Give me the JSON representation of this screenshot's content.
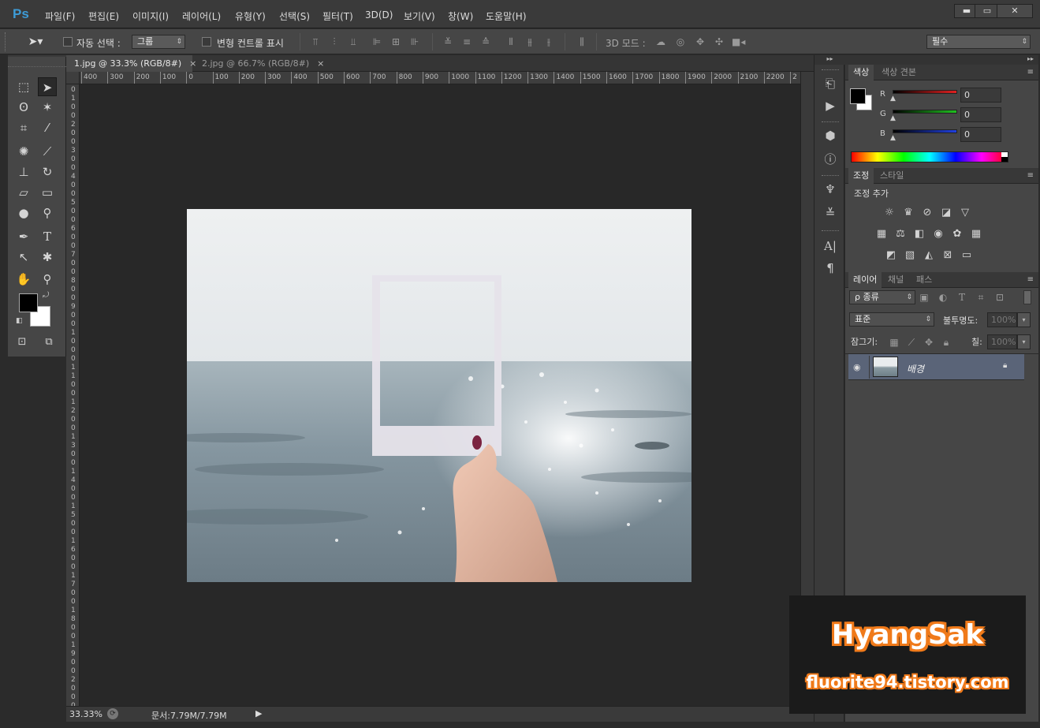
{
  "app": {
    "logo": "Ps"
  },
  "menu": [
    "파일(F)",
    "편집(E)",
    "이미지(I)",
    "레이어(L)",
    "유형(Y)",
    "선택(S)",
    "필터(T)",
    "3D(D)",
    "보기(V)",
    "창(W)",
    "도움말(H)"
  ],
  "window_controls": {
    "minimize": "▬",
    "maximize": "▭",
    "close": "✕"
  },
  "options": {
    "auto_select_label": "자동 선택 :",
    "auto_select_value": "그룹",
    "transform_label": "변형 컨트롤 표시",
    "mode_3d_label": "3D 모드 :",
    "workspace_value": "필수"
  },
  "documents": {
    "tabs": [
      {
        "label": "1.jpg @ 33.3% (RGB/8#)",
        "close": "×"
      },
      {
        "label": "2.jpg @ 66.7% (RGB/8#)",
        "close": "×"
      }
    ],
    "ruler_top": [
      "400",
      "300",
      "200",
      "100",
      "0",
      "100",
      "200",
      "300",
      "400",
      "500",
      "600",
      "700",
      "800",
      "900",
      "1000",
      "1100",
      "1200",
      "1300",
      "1400",
      "1500",
      "1600",
      "1700",
      "1800",
      "1900",
      "2000",
      "2100",
      "2200",
      "2"
    ],
    "ruler_left": [
      "0",
      "1",
      "0",
      "0",
      "2",
      "0",
      "0",
      "3",
      "0",
      "0",
      "4",
      "0",
      "0",
      "5",
      "0",
      "0",
      "6",
      "0",
      "0",
      "7",
      "0",
      "0",
      "8",
      "0",
      "0",
      "9",
      "0",
      "0",
      "1",
      "0",
      "0",
      "0",
      "1",
      "1",
      "0",
      "0",
      "1",
      "2",
      "0",
      "0",
      "1",
      "3",
      "0",
      "0",
      "1",
      "4",
      "0",
      "0",
      "1",
      "5",
      "0",
      "0",
      "1",
      "6",
      "0",
      "0",
      "1",
      "7",
      "0",
      "0",
      "1",
      "8",
      "0",
      "0",
      "1",
      "9",
      "0",
      "0",
      "2",
      "0",
      "0",
      "0"
    ],
    "status_zoom": "33.33%",
    "status_doc": "문서:7.79M/7.79M"
  },
  "panels": {
    "color": {
      "tabs": [
        "색상",
        "색상 견본"
      ],
      "channels": [
        {
          "label": "R",
          "value": "0",
          "color": "#e02020"
        },
        {
          "label": "G",
          "value": "0",
          "color": "#20c020"
        },
        {
          "label": "B",
          "value": "0",
          "color": "#2040e0"
        }
      ]
    },
    "adjustments": {
      "tabs": [
        "조정",
        "스타일"
      ],
      "add_label": "조정 추가"
    },
    "layers": {
      "tabs": [
        "레이어",
        "채널",
        "패스"
      ],
      "filter_label": "ρ 종류",
      "blend_mode": "표준",
      "opacity_label": "불투명도:",
      "opacity_value": "100%",
      "lock_label": "잠그기:",
      "fill_label": "칠:",
      "fill_value": "100%",
      "layer_name": "배경"
    }
  },
  "watermark": {
    "title": "HyangSak",
    "url": "fluorite94.tistory.com"
  },
  "colors": {
    "accent": "#3d9bd6",
    "watermark_outline": "#f07a1a",
    "layer_selected": "#5a6478"
  }
}
